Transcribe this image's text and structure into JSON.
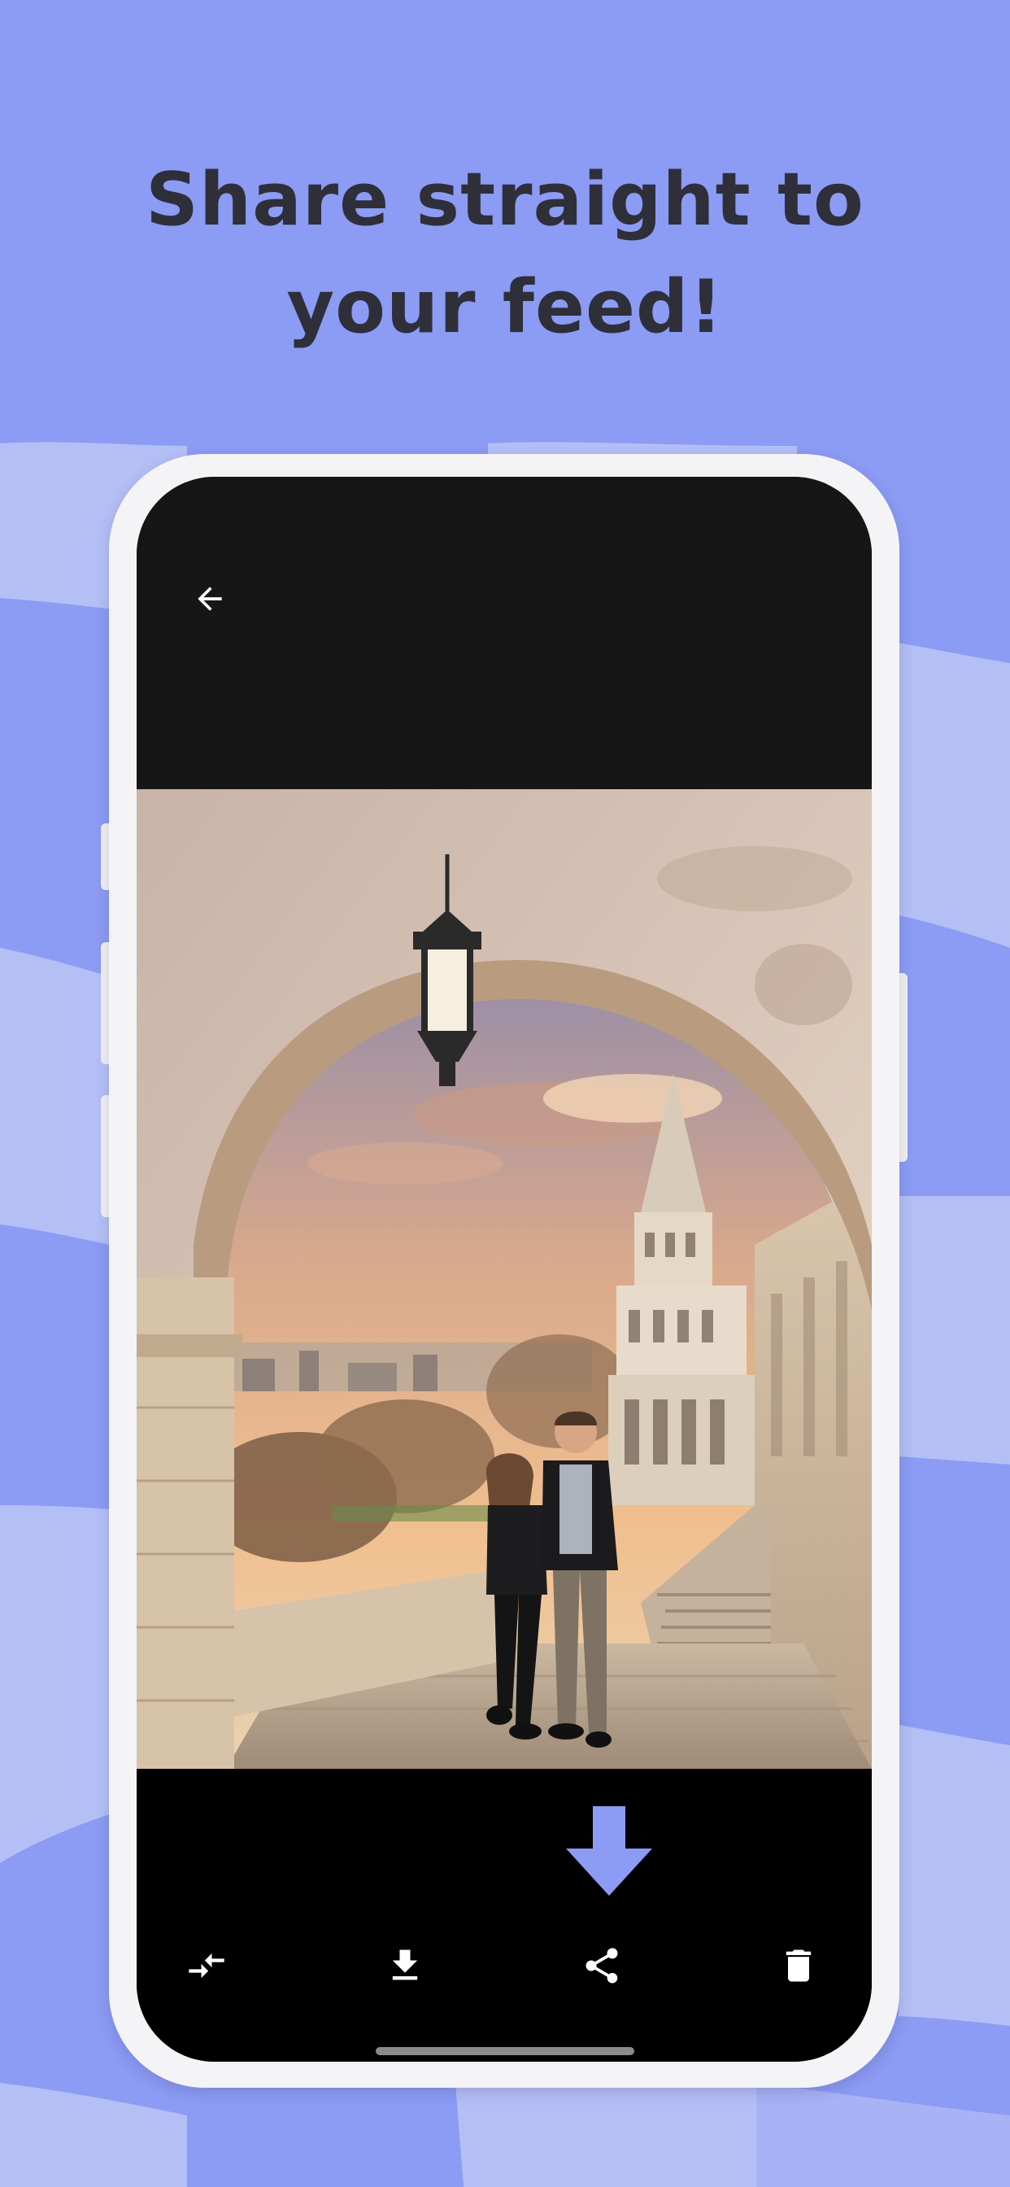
{
  "headline": {
    "line1": "Share straight to",
    "line2": "your feed!"
  },
  "colors": {
    "background": "#8c9bf4",
    "wave_light": "#b4bff6",
    "accent_arrow": "#8c9bf4",
    "toolbar_bg": "#000000",
    "top_bar_bg": "#161616"
  },
  "screen": {
    "back_icon": "arrow-left-icon",
    "photo_description_icon": "photo-image",
    "toolbar": [
      {
        "icon": "compare-arrows-icon",
        "action": "compare"
      },
      {
        "icon": "download-icon",
        "action": "download"
      },
      {
        "icon": "share-icon",
        "action": "share"
      },
      {
        "icon": "delete-icon",
        "action": "delete"
      }
    ],
    "hint": {
      "icon": "down-arrow-hint-icon",
      "points_to": "share"
    }
  }
}
